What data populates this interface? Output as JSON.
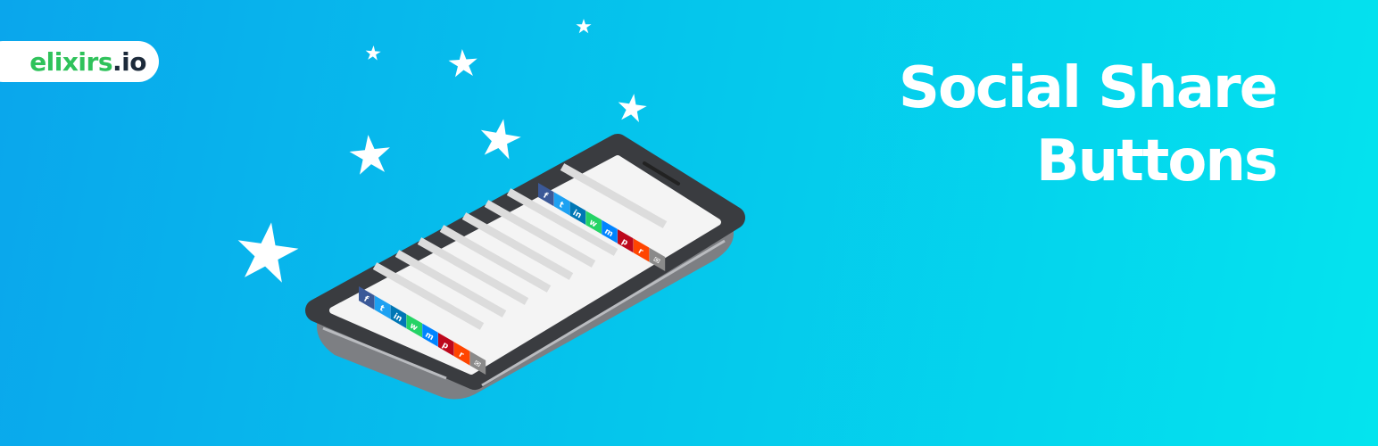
{
  "logo": {
    "name": "elixirs",
    "tld": ".io"
  },
  "headline": {
    "line1": "Social Share",
    "line2": "Buttons"
  },
  "share_buttons": [
    {
      "network": "facebook",
      "glyph": "f",
      "color": "#3b5998",
      "icon": "facebook-icon"
    },
    {
      "network": "twitter",
      "glyph": "t",
      "color": "#1da1f2",
      "icon": "twitter-bird-icon"
    },
    {
      "network": "linkedin",
      "glyph": "in",
      "color": "#0077b5",
      "icon": "linkedin-icon"
    },
    {
      "network": "whatsapp",
      "glyph": "w",
      "color": "#25d366",
      "icon": "whatsapp-icon"
    },
    {
      "network": "messenger",
      "glyph": "m",
      "color": "#0084ff",
      "icon": "messenger-icon"
    },
    {
      "network": "pinterest",
      "glyph": "p",
      "color": "#bd081c",
      "icon": "pinterest-icon"
    },
    {
      "network": "reddit",
      "glyph": "r",
      "color": "#ff4500",
      "icon": "reddit-icon"
    },
    {
      "network": "email",
      "glyph": "✉",
      "color": "#8a8a8a",
      "icon": "envelope-icon"
    }
  ],
  "colors": {
    "background_start": "#0aa6ec",
    "background_end": "#04e4ee",
    "logo_green": "#2fc25b",
    "logo_dark": "#1c2a3a"
  }
}
